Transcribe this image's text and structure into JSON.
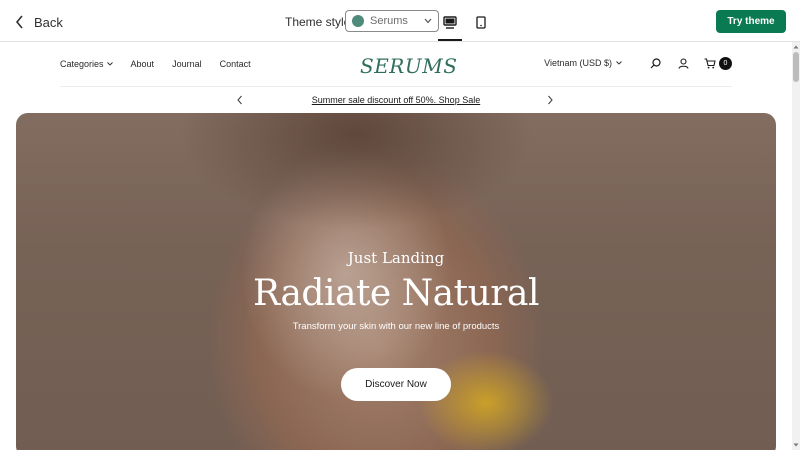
{
  "topbar": {
    "back_label": "Back",
    "theme_styles_label": "Theme styles",
    "theme_select": {
      "value": "Serums",
      "swatch_color": "#4f8a7a"
    },
    "devices": [
      "desktop-icon",
      "mobile-icon"
    ],
    "active_device": "desktop",
    "try_theme_label": "Try theme",
    "accent_color": "#0a7a52"
  },
  "store": {
    "nav": {
      "left_items": [
        {
          "label": "Categories",
          "has_dropdown": true
        },
        {
          "label": "About"
        },
        {
          "label": "Journal"
        },
        {
          "label": "Contact"
        }
      ],
      "logo": "SERUMS",
      "logo_color": "#2f6e5c",
      "currency": "Vietnam (USD $)",
      "icons": [
        "search-icon",
        "account-icon",
        "cart-icon"
      ],
      "cart_count": "0"
    },
    "announcement": {
      "text": "Summer sale discount off 50%. Shop Sale"
    },
    "hero": {
      "eyebrow": "Just Landing",
      "headline": "Radiate Natural",
      "subtext": "Transform your skin with our new line of products",
      "cta": "Discover Now"
    }
  }
}
